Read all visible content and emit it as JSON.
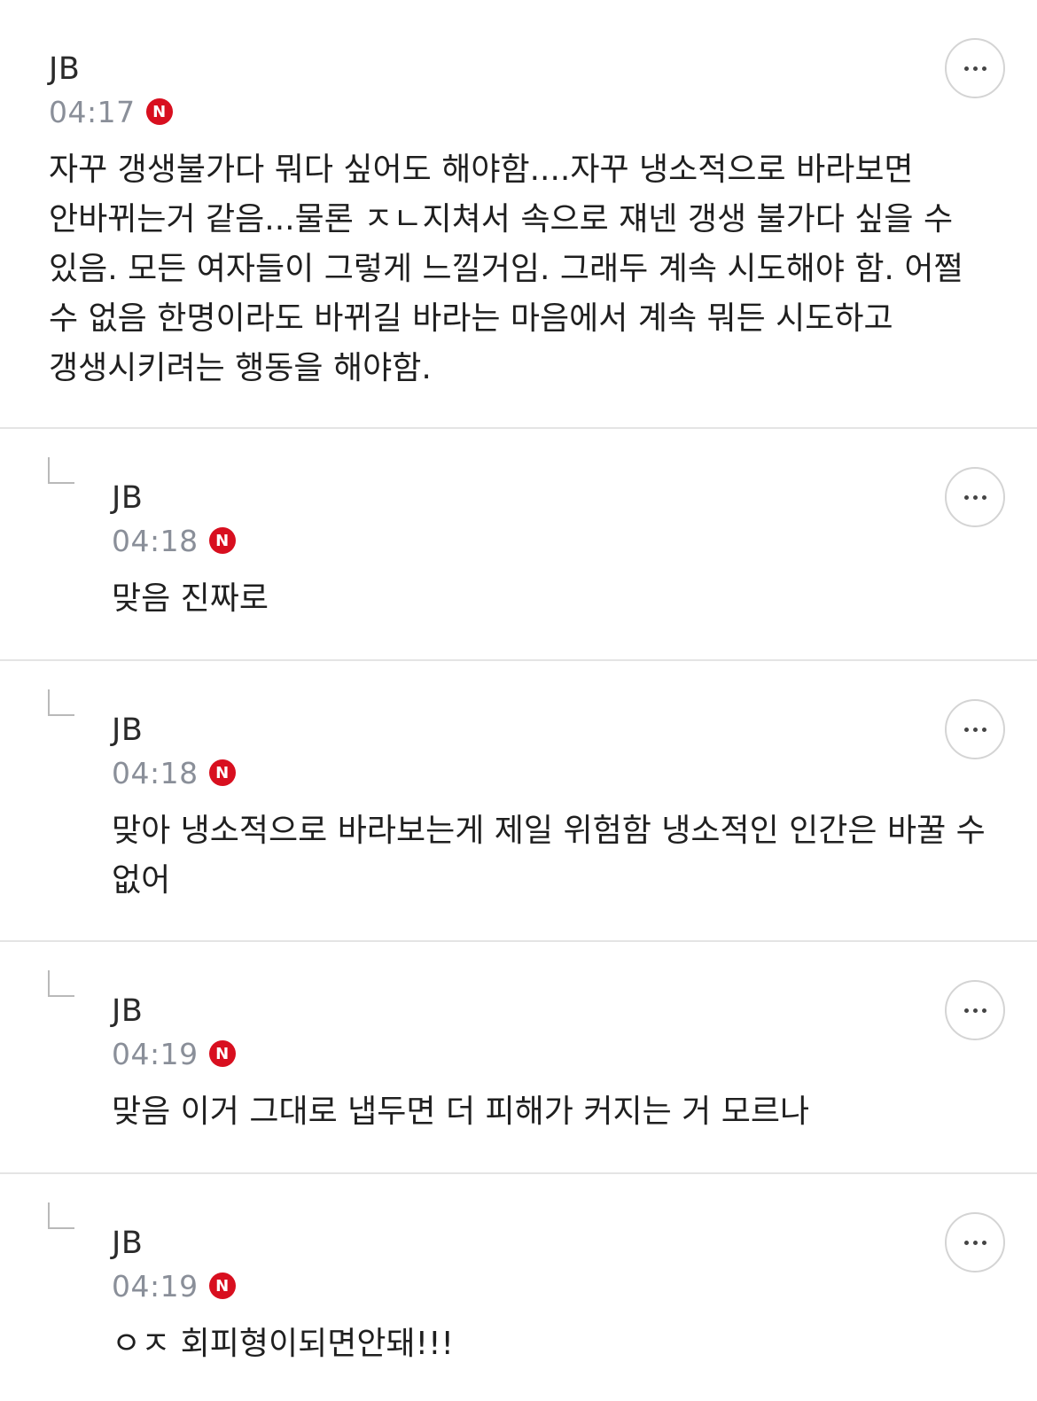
{
  "comments": [
    {
      "author": "JB",
      "time": "04:17",
      "badge": "N",
      "text": "자꾸 갱생불가다 뭐다 싶어도 해야함....자꾸 냉소적으로 바라보면 안바뀌는거 같음...물론 ㅈㄴ지쳐서 속으로 쟤넨 갱생 불가다 싶을 수 있음. 모든 여자들이 그렇게 느낄거임. 그래두 계속 시도해야 함. 어쩔 수 없음 한명이라도 바뀌길 바라는 마음에서 계속 뭐든 시도하고 갱생시키려는 행동을 해야함.",
      "is_reply": false
    },
    {
      "author": "JB",
      "time": "04:18",
      "badge": "N",
      "text": "맞음 진짜로",
      "is_reply": true
    },
    {
      "author": "JB",
      "time": "04:18",
      "badge": "N",
      "text": "맞아 냉소적으로 바라보는게 제일 위험함 냉소적인 인간은 바꿀 수 없어",
      "is_reply": true
    },
    {
      "author": "JB",
      "time": "04:19",
      "badge": "N",
      "text": "맞음 이거 그대로 냅두면 더 피해가 커지는 거 모르나",
      "is_reply": true
    },
    {
      "author": "JB",
      "time": "04:19",
      "badge": "N",
      "text": "ㅇㅈ 회피형이되면안돼!!!",
      "is_reply": true
    }
  ],
  "icons": {
    "more": "more-options-icon",
    "reply": "reply-arrow-icon",
    "new": "new-badge-icon"
  },
  "colors": {
    "badge": "#d80f1f",
    "time": "#8a8f99",
    "divider": "#e4e4e4"
  }
}
